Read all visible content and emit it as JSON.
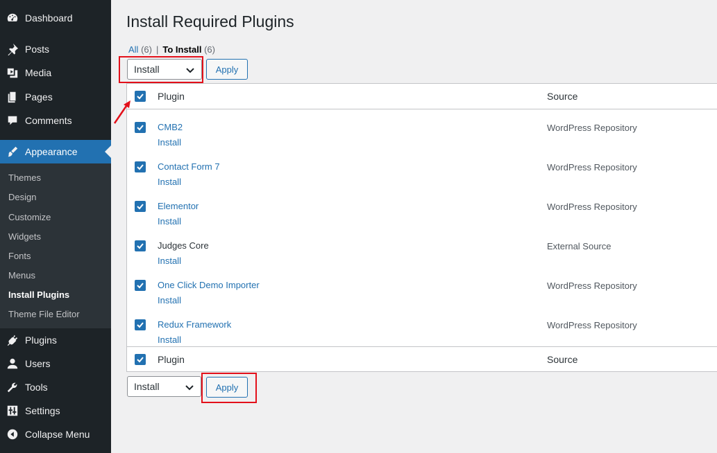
{
  "sidebar": {
    "items": [
      {
        "label": "Dashboard",
        "icon": "dashboard-icon"
      },
      {
        "label": "Posts",
        "icon": "pin-icon"
      },
      {
        "label": "Media",
        "icon": "media-icon"
      },
      {
        "label": "Pages",
        "icon": "pages-icon"
      },
      {
        "label": "Comments",
        "icon": "comment-icon"
      },
      {
        "label": "Appearance",
        "icon": "brush-icon"
      },
      {
        "label": "Plugins",
        "icon": "plugin-icon"
      },
      {
        "label": "Users",
        "icon": "users-icon"
      },
      {
        "label": "Tools",
        "icon": "wrench-icon"
      },
      {
        "label": "Settings",
        "icon": "sliders-icon"
      },
      {
        "label": "Collapse Menu",
        "icon": "collapse-icon"
      }
    ],
    "submenu": [
      "Themes",
      "Design",
      "Customize",
      "Widgets",
      "Fonts",
      "Menus",
      "Install Plugins",
      "Theme File Editor"
    ]
  },
  "page": {
    "title": "Install Required Plugins",
    "filter_all": "All",
    "filter_all_count": "(6)",
    "filter_sep": "|",
    "filter_install": "To Install",
    "filter_install_count": "(6)"
  },
  "bulk": {
    "top_select": "Install",
    "bottom_select": "Install",
    "apply_label": "Apply"
  },
  "table": {
    "col_plugin": "Plugin",
    "col_source": "Source",
    "rows": [
      {
        "name": "CMB2",
        "action": "Install",
        "source": "WordPress Repository"
      },
      {
        "name": "Contact Form 7",
        "action": "Install",
        "source": "WordPress Repository"
      },
      {
        "name": "Elementor",
        "action": "Install",
        "source": "WordPress Repository"
      },
      {
        "name": "Judges Core",
        "action": "Install",
        "source": "External Source"
      },
      {
        "name": "One Click Demo Importer",
        "action": "Install",
        "source": "WordPress Repository"
      },
      {
        "name": "Redux Framework",
        "action": "Install",
        "source": "WordPress Repository"
      }
    ]
  },
  "colors": {
    "sidebar_bg": "#1d2327",
    "accent": "#2271b1",
    "highlight": "#e3101a"
  }
}
